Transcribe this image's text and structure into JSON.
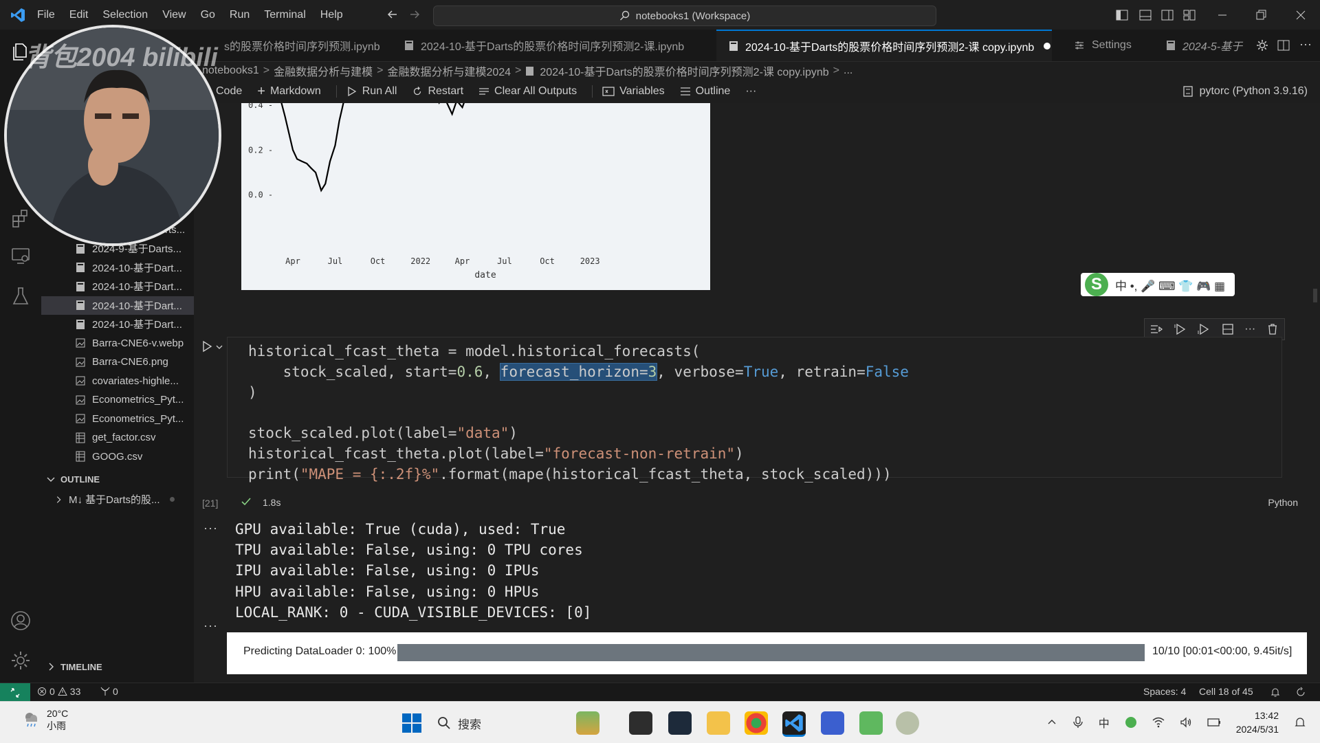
{
  "window": {
    "title": "notebooks1 (Workspace)",
    "menu": [
      "File",
      "Edit",
      "Selection",
      "View",
      "Go",
      "Run",
      "Terminal",
      "Help"
    ]
  },
  "tabs": [
    {
      "label": "s的股票价格时间序列预测.ipynb",
      "active": false
    },
    {
      "label": "2024-10-基于Darts的股票价格时间序列预测2-课.ipynb",
      "active": false
    },
    {
      "label": "2024-10-基于Darts的股票价格时间序列预测2-课 copy.ipynb",
      "active": true,
      "dirty": true
    },
    {
      "label": "Settings",
      "active": false
    },
    {
      "label": "2024-5-基于",
      "active": false
    }
  ],
  "breadcrumb": [
    "notebooks1",
    "金融数据分析与建模",
    "金融数据分析与建模2024",
    "2024-10-基于Darts的股票价格时间序列预测2-课 copy.ipynb",
    "..."
  ],
  "toolbar": {
    "code": "Code",
    "markdown": "Markdown",
    "run_all": "Run All",
    "restart": "Restart",
    "clear_outputs": "Clear All Outputs",
    "variables": "Variables",
    "outline": "Outline",
    "more": "···",
    "kernel": "pytorc (Python 3.9.16)"
  },
  "sidebar": {
    "partial_item": "rts...",
    "files": [
      {
        "name": "2024-9-基于Darts...",
        "type": "notebook",
        "active": false
      },
      {
        "name": "2024-10-基于Dart...",
        "type": "notebook",
        "active": false
      },
      {
        "name": "2024-10-基于Dart...",
        "type": "notebook",
        "active": false
      },
      {
        "name": "2024-10-基于Dart...",
        "type": "notebook",
        "active": true
      },
      {
        "name": "2024-10-基于Dart...",
        "type": "notebook",
        "active": false
      },
      {
        "name": "Barra-CNE6-v.webp",
        "type": "image",
        "active": false
      },
      {
        "name": "Barra-CNE6.png",
        "type": "image",
        "active": false
      },
      {
        "name": "covariates-highle...",
        "type": "image",
        "active": false
      },
      {
        "name": "Econometrics_Pyt...",
        "type": "image",
        "active": false
      },
      {
        "name": "Econometrics_Pyt...",
        "type": "image",
        "active": false
      },
      {
        "name": "get_factor.csv",
        "type": "csv",
        "active": false
      },
      {
        "name": "GOOG.csv",
        "type": "csv",
        "active": false
      }
    ],
    "outline_header": "OUTLINE",
    "outline_item": "M↓ 基于Darts的股...",
    "timeline_header": "TIMELINE"
  },
  "chart_data": {
    "type": "line",
    "xlabel": "date",
    "x_ticks": [
      "Apr",
      "Jul",
      "Oct",
      "2022",
      "Apr",
      "Jul",
      "Oct",
      "2023"
    ],
    "y_ticks": [
      "0.0",
      "0.2",
      "0.4"
    ],
    "ylim": [
      -0.05,
      0.47
    ],
    "series": [
      {
        "x": [
          "2021-03-01",
          "2021-03-15",
          "2021-04-01",
          "2021-04-10",
          "2021-04-20",
          "2021-05-01",
          "2021-05-10",
          "2021-05-20",
          "2021-06-01",
          "2021-06-10",
          "2021-06-20",
          "2021-07-01",
          "2021-07-10",
          "2021-07-20",
          "2021-08-01"
        ],
        "y": [
          0.46,
          0.35,
          0.2,
          0.16,
          0.15,
          0.14,
          0.12,
          0.1,
          0.02,
          0.05,
          0.15,
          0.22,
          0.33,
          0.42,
          0.47
        ]
      },
      {
        "x": [
          "2022-01-10",
          "2022-01-20",
          "2022-02-01",
          "2022-02-10",
          "2022-02-20",
          "2022-03-01",
          "2022-03-10",
          "2022-03-20",
          "2022-04-01",
          "2022-04-10",
          "2022-04-20"
        ],
        "y": [
          0.47,
          0.43,
          0.45,
          0.41,
          0.44,
          0.4,
          0.36,
          0.42,
          0.39,
          0.44,
          0.46
        ]
      }
    ],
    "line_color": "#000000",
    "background": "#f0f3f6"
  },
  "ime": {
    "label": "中 •, 🎤 ⌨ 👕 🎮 ▦"
  },
  "cell": {
    "exec_count": "[21]",
    "exec_time": "1.8s",
    "language": "Python",
    "code": [
      "historical_fcast_theta = model.historical_forecasts(",
      "    stock_scaled, start=0.6, forecast_horizon=3, verbose=True, retrain=False",
      ")",
      "",
      "stock_scaled.plot(label=\"data\")",
      "historical_fcast_theta.plot(label=\"forecast-non-retrain\")",
      "print(\"MAPE = {:.2f}%\".format(mape(historical_fcast_theta, stock_scaled)))"
    ]
  },
  "output": {
    "lines": [
      "GPU available: True (cuda), used: True",
      "TPU available: False, using: 0 TPU cores",
      "IPU available: False, using: 0 IPUs",
      "HPU available: False, using: 0 HPUs",
      "LOCAL_RANK: 0 - CUDA_VISIBLE_DEVICES: [0]"
    ],
    "progress": {
      "label": "Predicting DataLoader 0: 100%",
      "fraction": 1.0,
      "stats": "10/10 [00:01<00:00, 9.45it/s]"
    }
  },
  "statusbar": {
    "errors": "0",
    "warnings": "33",
    "ports": "0",
    "spaces": "Spaces: 4",
    "cell_pos": "Cell 18 of 45"
  },
  "taskbar": {
    "temp": "20°C",
    "weather": "小雨",
    "search": "搜索",
    "time": "13:42",
    "date": "2024/5/31",
    "ime": "中"
  },
  "overlay": {
    "watermark": "背包2004 bilibili"
  },
  "colors": {
    "accent": "#0078d4",
    "remote": "#16825d",
    "editor_bg": "#1f1f1f"
  }
}
